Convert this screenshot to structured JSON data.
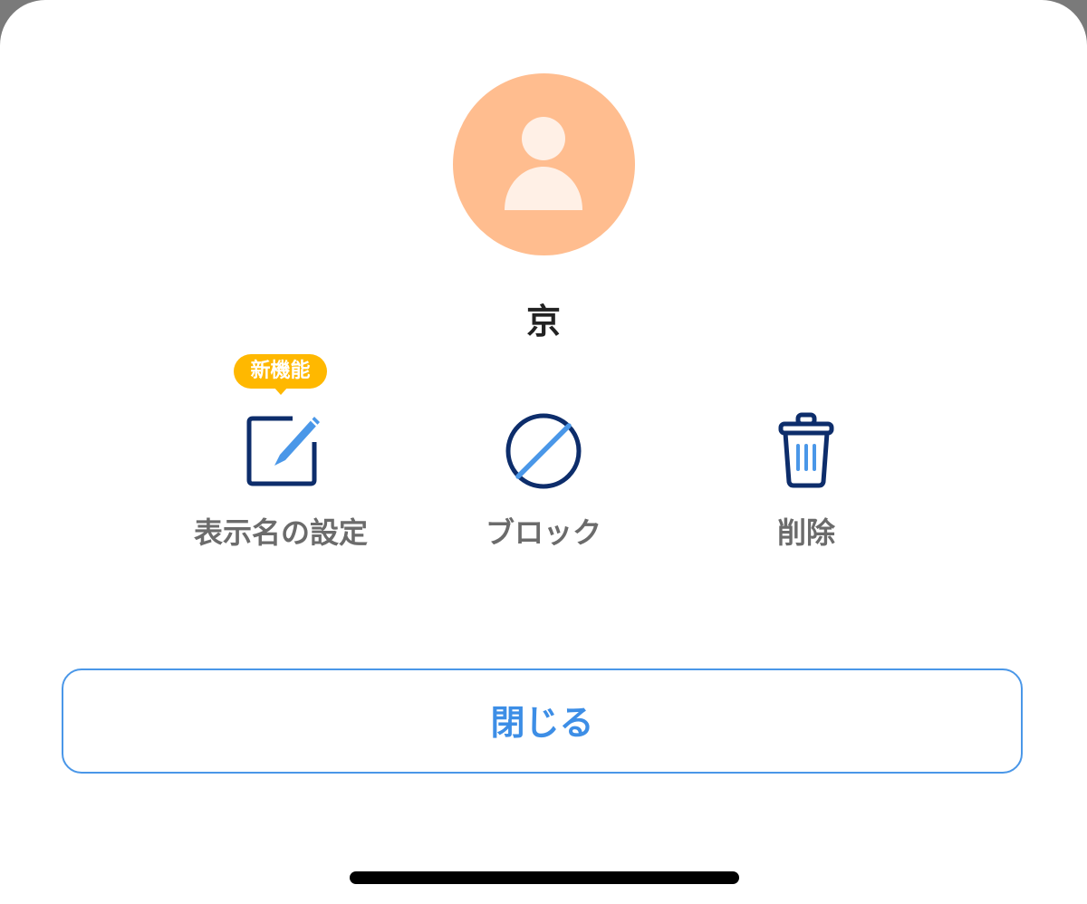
{
  "profile": {
    "name": "京",
    "avatar_icon": "person-icon",
    "avatar_color": "#ffbd8f"
  },
  "actions": {
    "edit": {
      "label": "表示名の設定",
      "icon": "edit-icon",
      "badge": "新機能"
    },
    "block": {
      "label": "ブロック",
      "icon": "block-icon"
    },
    "delete": {
      "label": "削除",
      "icon": "trash-icon"
    }
  },
  "footer": {
    "close_label": "閉じる"
  },
  "colors": {
    "accent": "#3d8ee6",
    "icon_dark": "#0d2d6b",
    "badge": "#ffb800",
    "label": "#6b6b6b"
  }
}
